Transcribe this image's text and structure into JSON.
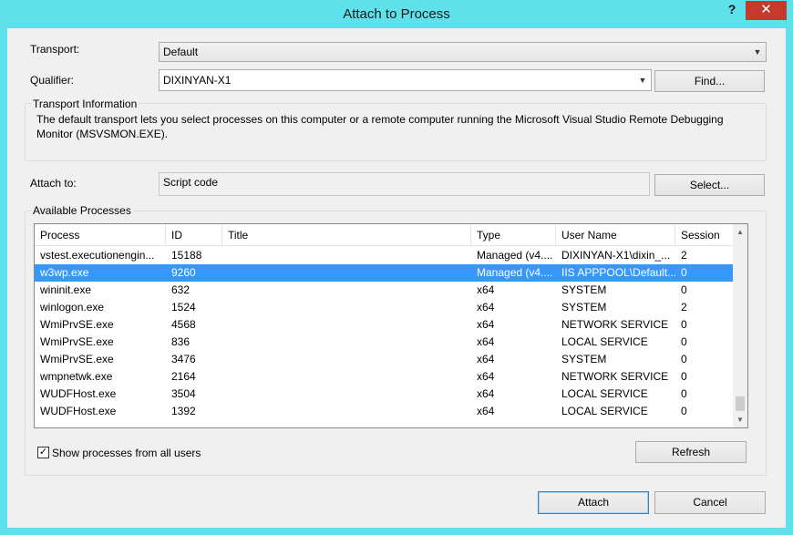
{
  "window": {
    "title": "Attach to Process",
    "help_glyph": "?",
    "close_glyph": "✕"
  },
  "transport": {
    "label": "Transport:",
    "value": "Default"
  },
  "qualifier": {
    "label": "Qualifier:",
    "value": "DIXINYAN-X1",
    "find_button": "Find..."
  },
  "transport_info": {
    "title": "Transport Information",
    "text": "The default transport lets you select processes on this computer or a remote computer running the Microsoft Visual Studio Remote Debugging Monitor (MSVSMON.EXE)."
  },
  "attach_to": {
    "label": "Attach to:",
    "value": "Script code",
    "select_button": "Select..."
  },
  "available_processes": {
    "title": "Available Processes",
    "columns": [
      "Process",
      "ID",
      "Title",
      "Type",
      "User Name",
      "Session"
    ],
    "rows": [
      {
        "process": "vstest.executionengin...",
        "id": "15188",
        "title": "",
        "type": "Managed (v4....",
        "user": "DIXINYAN-X1\\dixin_...",
        "session": "2"
      },
      {
        "process": "w3wp.exe",
        "id": "9260",
        "title": "",
        "type": "Managed (v4....",
        "user": "IIS APPPOOL\\Default...",
        "session": "0"
      },
      {
        "process": "wininit.exe",
        "id": "632",
        "title": "",
        "type": "x64",
        "user": "SYSTEM",
        "session": "0"
      },
      {
        "process": "winlogon.exe",
        "id": "1524",
        "title": "",
        "type": "x64",
        "user": "SYSTEM",
        "session": "2"
      },
      {
        "process": "WmiPrvSE.exe",
        "id": "4568",
        "title": "",
        "type": "x64",
        "user": "NETWORK SERVICE",
        "session": "0"
      },
      {
        "process": "WmiPrvSE.exe",
        "id": "836",
        "title": "",
        "type": "x64",
        "user": "LOCAL SERVICE",
        "session": "0"
      },
      {
        "process": "WmiPrvSE.exe",
        "id": "3476",
        "title": "",
        "type": "x64",
        "user": "SYSTEM",
        "session": "0"
      },
      {
        "process": "wmpnetwk.exe",
        "id": "2164",
        "title": "",
        "type": "x64",
        "user": "NETWORK SERVICE",
        "session": "0"
      },
      {
        "process": "WUDFHost.exe",
        "id": "3504",
        "title": "",
        "type": "x64",
        "user": "LOCAL SERVICE",
        "session": "0"
      },
      {
        "process": "WUDFHost.exe",
        "id": "1392",
        "title": "",
        "type": "x64",
        "user": "LOCAL SERVICE",
        "session": "0"
      }
    ],
    "selected_row_index": 1,
    "show_all_users_label": "Show processes from all users",
    "show_all_users_checked": true,
    "refresh_button": "Refresh"
  },
  "footer": {
    "attach_button": "Attach",
    "cancel_button": "Cancel"
  },
  "colors": {
    "frame": "#5ee1ea",
    "close": "#c7392c",
    "selection": "#3399ff"
  }
}
